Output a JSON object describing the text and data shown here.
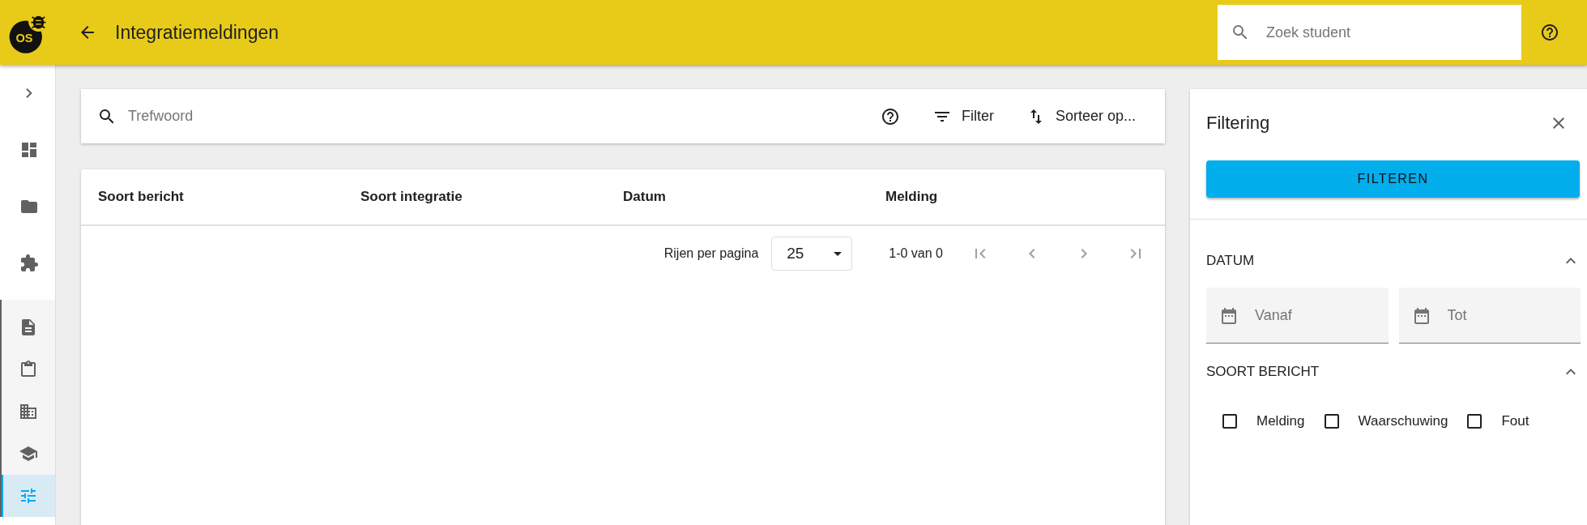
{
  "header": {
    "logo_text": "OS",
    "title": "Integratiemeldingen",
    "search": {
      "placeholder": "Zoek student"
    }
  },
  "sidebar": {
    "items": [
      {
        "selected": false
      },
      {
        "selected": false
      },
      {
        "selected": false
      }
    ],
    "sub_items": [
      {
        "selected": false
      },
      {
        "selected": false
      },
      {
        "selected": false
      },
      {
        "selected": false
      },
      {
        "selected": true
      }
    ]
  },
  "toolbar": {
    "search": {
      "placeholder": "Trefwoord"
    },
    "filter_label": "Filter",
    "sort_label": "Sorteer op..."
  },
  "table": {
    "columns": [
      "Soort bericht",
      "Soort integratie",
      "Datum",
      "Melding"
    ],
    "pagination": {
      "rows_per_page_label": "Rijen per pagina",
      "rows_per_page": "25",
      "range": "1-0 van 0"
    }
  },
  "filter_panel": {
    "title": "Filtering",
    "apply_button": "FILTEREN",
    "sections": [
      {
        "kind": "dates",
        "title": "DATUM",
        "expanded": true,
        "fields": [
          {
            "placeholder": "Vanaf"
          },
          {
            "placeholder": "Tot"
          }
        ]
      },
      {
        "kind": "checkboxes",
        "title": "SOORT BERICHT",
        "expanded": true,
        "options": [
          {
            "label": "Melding",
            "checked": false
          },
          {
            "label": "Waarschuwing",
            "checked": false
          },
          {
            "label": "Fout",
            "checked": false
          }
        ]
      }
    ]
  }
}
